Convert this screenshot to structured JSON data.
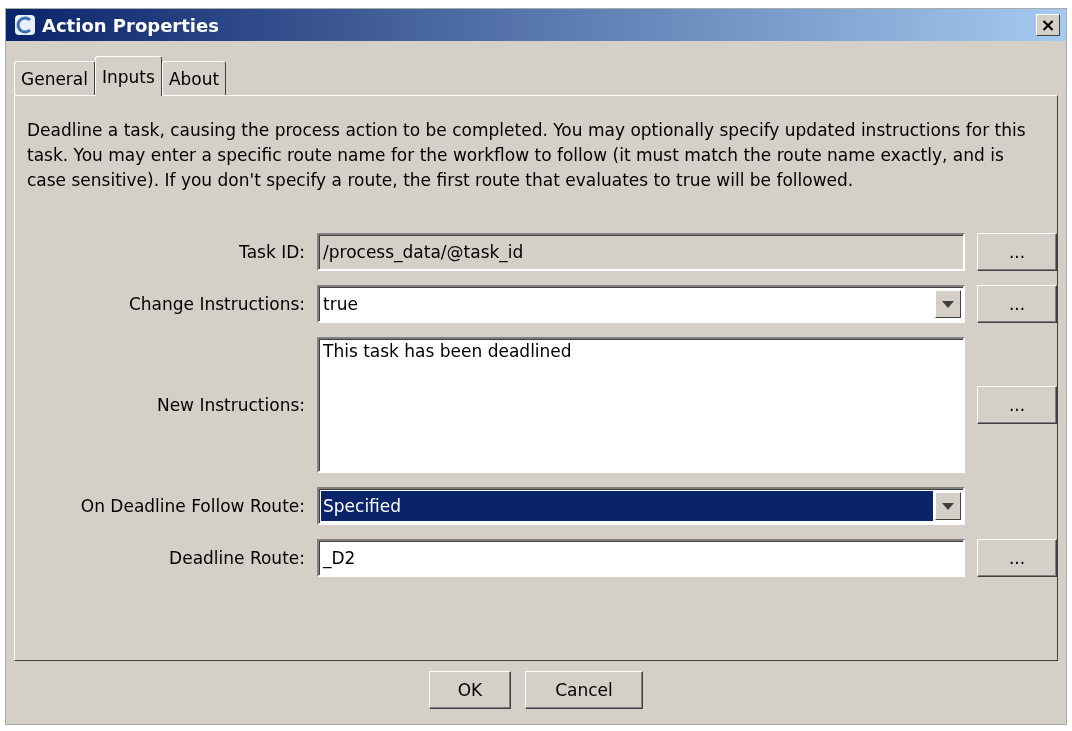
{
  "window": {
    "title": "Action Properties",
    "close": "×"
  },
  "tabs": [
    {
      "label": "General",
      "selected": false
    },
    {
      "label": "Inputs",
      "selected": true
    },
    {
      "label": "About",
      "selected": false
    }
  ],
  "description": "Deadline a task, causing the process action to be completed. You may optionally specify updated instructions for this task. You may enter a specific route name for the workflow to follow (it must match the route name exactly, and is case sensitive). If you don't specify a route, the first route that evaluates to true will be followed.",
  "fields": [
    {
      "kind": "text",
      "label": "Task ID:",
      "value": "/process_data/@task_id",
      "editable": false,
      "browse": "..."
    },
    {
      "kind": "combo",
      "label": "Change Instructions:",
      "value": "true",
      "selected": false,
      "browse": "..."
    },
    {
      "kind": "textarea",
      "label": "New Instructions:",
      "value": "This task has been deadlined",
      "browse": "..."
    },
    {
      "kind": "combo",
      "label": "On Deadline Follow Route:",
      "value": "Specified",
      "selected": true
    },
    {
      "kind": "text",
      "label": "Deadline Route:",
      "value": "_D2",
      "editable": true,
      "browse": "..."
    }
  ],
  "buttons": [
    "OK",
    "Cancel"
  ]
}
